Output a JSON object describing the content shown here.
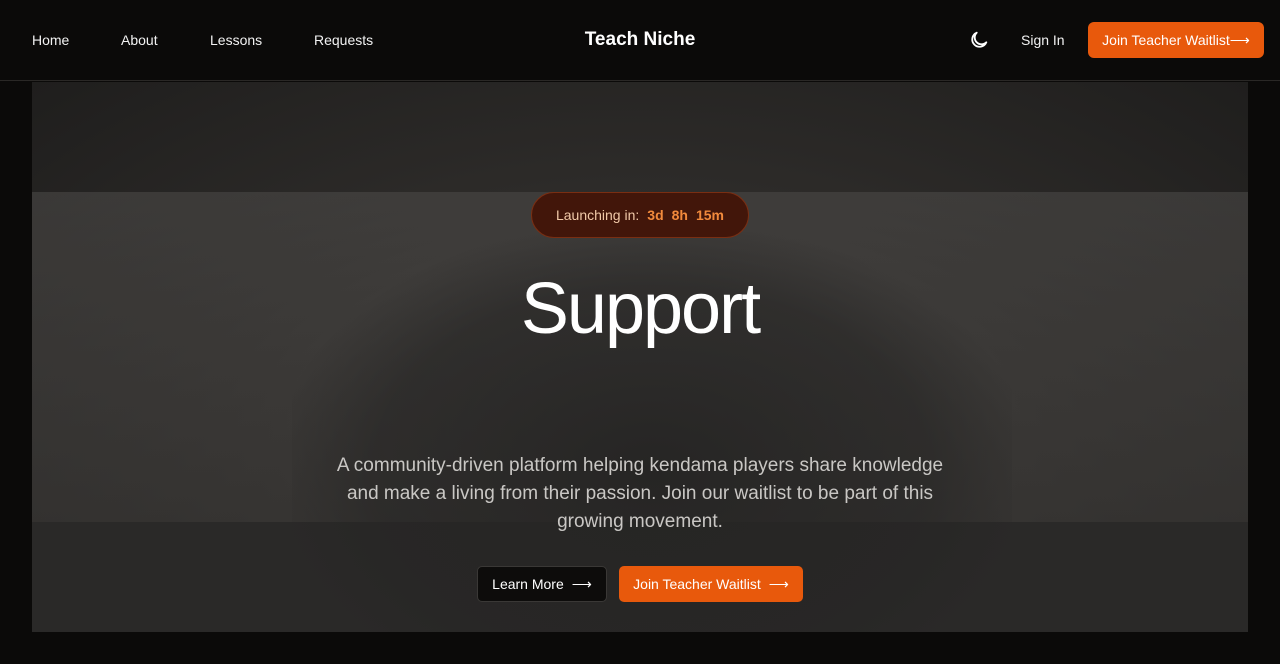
{
  "nav": {
    "links": [
      "Home",
      "About",
      "Lessons",
      "Requests"
    ],
    "brand": "Teach Niche",
    "sign_in": "Sign In",
    "cta": "Join Teacher Waitlist",
    "cta_arrow": "⟶",
    "theme_icon": "moon-icon"
  },
  "hero": {
    "countdown_label": "Launching in:",
    "days": "3d",
    "hours": "8h",
    "minutes": "15m",
    "title": "Support",
    "description": "A community-driven platform helping kendama players share knowledge and make a living from their passion. Join our waitlist to be part of this growing movement.",
    "learn_more": "Learn More",
    "join": "Join Teacher Waitlist",
    "arrow": "⟶"
  },
  "colors": {
    "accent": "#e8590c",
    "badge_bg": "#42160a",
    "countdown": "#f28a3c"
  }
}
